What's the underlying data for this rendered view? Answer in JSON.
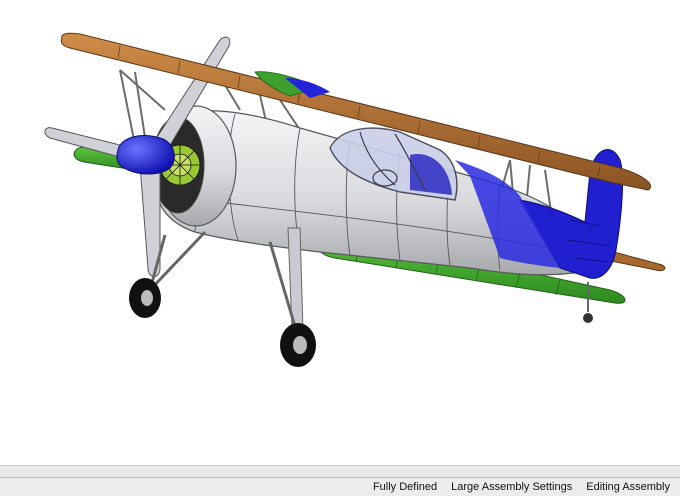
{
  "status_bar": {
    "fields": [
      "Fully Defined",
      "Large Assembly Settings",
      "Editing Assembly"
    ]
  },
  "colors": {
    "wing_top": "#b3733a",
    "wing_lower": "#3da02c",
    "fuselage": "#dcdde0",
    "tail": "#2020d0",
    "spinner": "#1a22e0",
    "engine": "#9ac832"
  }
}
